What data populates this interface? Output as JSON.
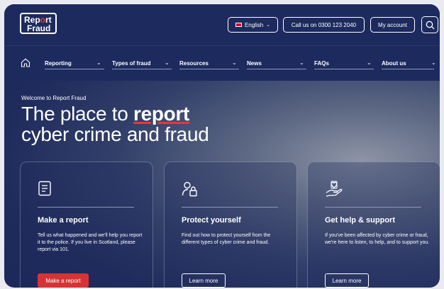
{
  "header": {
    "logo_line1": "Rep",
    "logo_dot": "o",
    "logo_line1b": "rt",
    "logo_line2": "Fraud",
    "language_label": "English",
    "call_label": "Call us on 0300 123 2040",
    "account_label": "My account"
  },
  "nav": {
    "items": [
      {
        "label": "Reporting"
      },
      {
        "label": "Types of fraud"
      },
      {
        "label": "Resources"
      },
      {
        "label": "News"
      },
      {
        "label": "FAQs"
      },
      {
        "label": "About us"
      }
    ]
  },
  "hero": {
    "eyebrow": "Welcome to Report Fraud",
    "title_part1": "The place to ",
    "title_bold": "report",
    "title_part2": "cyber crime and fraud"
  },
  "cards": [
    {
      "icon": "document-icon",
      "title": "Make a report",
      "body": "Tell us what happened and we'll help you report it to the police. If you live in Scotland, please report via 101.",
      "button": "Make a report"
    },
    {
      "icon": "user-lock-icon",
      "title": "Protect yourself",
      "body": "Find out how to protect yourself from the different types of cyber crime and fraud.",
      "button": "Learn more"
    },
    {
      "icon": "hand-heart-icon",
      "title": "Get help & support",
      "body": "If you've been affected by cyber crime or fraud, we're here to listen, to help, and to support you.",
      "button": "Learn more"
    }
  ],
  "colors": {
    "navy": "#1d2a5e",
    "accent_red": "#d63434"
  }
}
